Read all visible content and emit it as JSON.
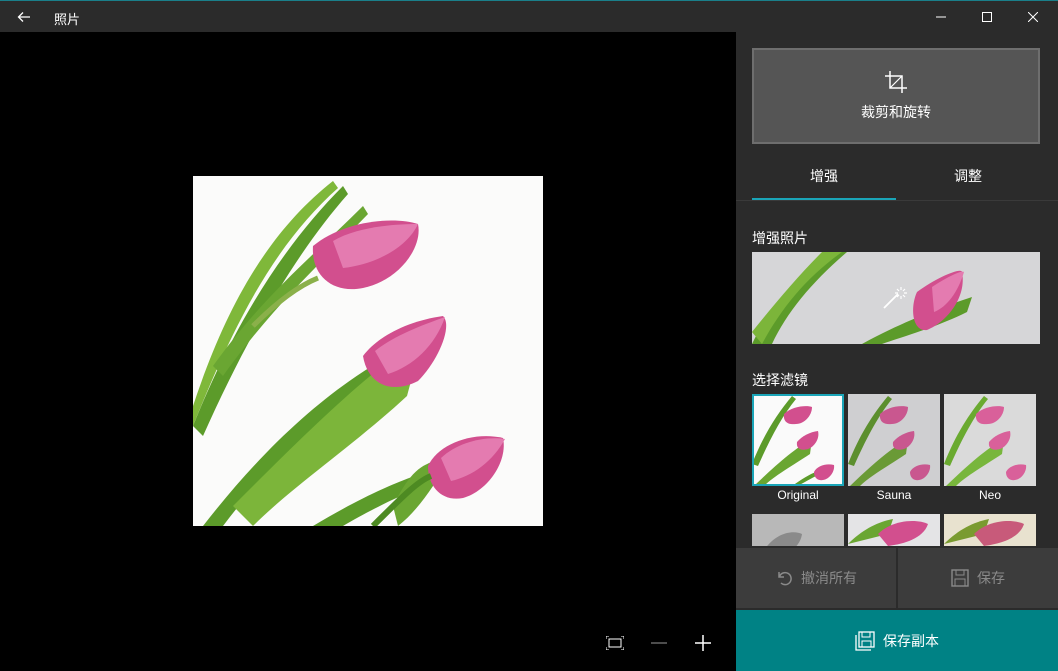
{
  "app": {
    "title": "照片"
  },
  "titlebar": {
    "back_icon": "back-arrow-icon",
    "controls": [
      "minimize-icon",
      "maximize-icon",
      "close-icon"
    ]
  },
  "canvas": {
    "controls": [
      "fit-to-screen-icon",
      "zoom-out-icon",
      "zoom-in-icon"
    ]
  },
  "panel": {
    "crop_button": {
      "label": "裁剪和旋转",
      "icon": "crop-icon"
    },
    "tabs": [
      {
        "label": "增强",
        "selected": true
      },
      {
        "label": "调整",
        "selected": false
      }
    ],
    "enhance": {
      "title": "增强照片",
      "icon": "magic-wand-icon"
    },
    "filters": {
      "title": "选择滤镜",
      "items": [
        {
          "label": "Original",
          "selected": true
        },
        {
          "label": "Sauna",
          "selected": false
        },
        {
          "label": "Neo",
          "selected": false
        }
      ]
    },
    "actions": {
      "undo_all": "撤消所有",
      "save": "保存",
      "save_copy": "保存副本"
    }
  },
  "colors": {
    "accent": "#008285",
    "tab_underline": "#1aa5b8",
    "panel_bg": "#2b2b2b",
    "tulip_pink": "#d0508e",
    "leaf_green": "#5f9e2a"
  }
}
